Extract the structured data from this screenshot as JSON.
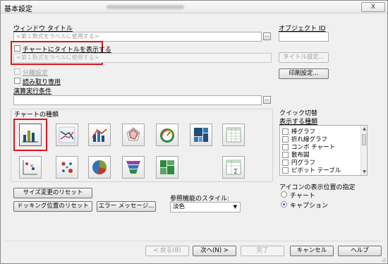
{
  "window": {
    "title": "基本設定",
    "close_label": "X"
  },
  "fields": {
    "window_title_label": "ウィンドウ タイトル",
    "window_title_placeholder": "<第１数式をラベルに使用する>",
    "object_id_label": "オブジェクト ID",
    "object_id_value": "",
    "show_chart_title_label": "チャートにタイトルを表示する",
    "chart_title_placeholder": "<第１数式をラベルに使用する>",
    "title_settings_button": "タイトル設定...",
    "print_settings_button": "印刷設定...",
    "split_settings_label": "分離設定",
    "read_only_label": "読み取り専用",
    "calc_condition_label": "演算実行条件",
    "calc_condition_value": "",
    "browse_button": "..."
  },
  "chart_types": {
    "label": "チャートの種類",
    "icons": [
      {
        "name": "bar-chart-icon",
        "selected": true
      },
      {
        "name": "line-chart-icon",
        "selected": false
      },
      {
        "name": "combo-chart-icon",
        "selected": false
      },
      {
        "name": "radar-chart-icon",
        "selected": false
      },
      {
        "name": "gauge-chart-icon",
        "selected": false
      },
      {
        "name": "block-chart-icon",
        "selected": false
      },
      {
        "name": "straight-table-icon",
        "selected": false
      },
      {
        "name": "scatter-chart-icon",
        "selected": false
      },
      {
        "name": "grid-chart-icon",
        "selected": false
      },
      {
        "name": "pie-chart-icon",
        "selected": false
      },
      {
        "name": "funnel-chart-icon",
        "selected": false
      },
      {
        "name": "mekko-chart-icon",
        "selected": false
      },
      {
        "name": "pivot-table-icon",
        "selected": false
      }
    ]
  },
  "quick_switch": {
    "label": "クイック切替",
    "list_label": "表示する種類",
    "items": [
      "棒グラフ",
      "折れ線グラフ",
      "コンボ チャート",
      "散布図",
      "円グラフ",
      "ピボット テーブル"
    ]
  },
  "icon_position": {
    "label": "アイコンの表示位置の指定",
    "options": [
      {
        "label": "チャート",
        "checked": false
      },
      {
        "label": "キャプション",
        "checked": true
      }
    ]
  },
  "reset_buttons": {
    "size_reset": "サイズ変更のリセット",
    "docking_reset": "ドッキング位置のリセット",
    "error_message": "エラー メッセージ..."
  },
  "reference_style": {
    "label": "参照機能のスタイル:",
    "value": "淡色"
  },
  "footer": {
    "back": "< 戻る(B)",
    "next": "次へ(N) >",
    "finish": "完了",
    "cancel": "キャンセル",
    "help": "ヘルプ"
  },
  "colors": {
    "highlight_red": "#e0141e",
    "bar_dark": "#1f4e79",
    "bar_olive": "#8a9a2a",
    "pie_blue": "#2e75b6",
    "gauge_green": "#2e8b3d"
  }
}
